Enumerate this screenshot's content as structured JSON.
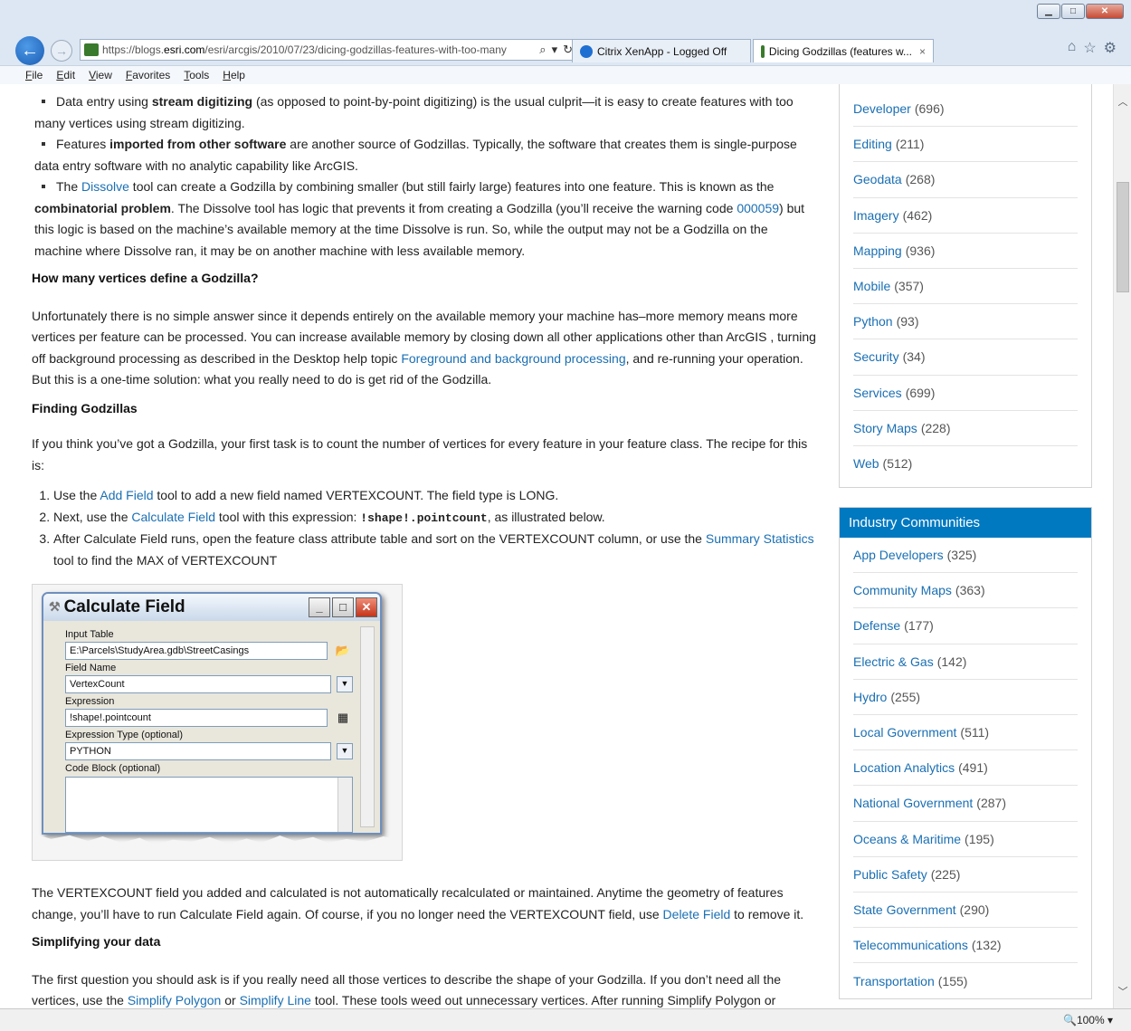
{
  "browser": {
    "url_prefix": "https://blogs.",
    "url_domain": "esri.com",
    "url_path": "/esri/arcgis/2010/07/23/dicing-godzillas-features-with-too-many",
    "tabs": [
      {
        "label": "Citrix XenApp - Logged Off"
      },
      {
        "label": "Dicing Godzillas (features w...",
        "close": "×"
      }
    ],
    "menu": [
      "File",
      "Edit",
      "View",
      "Favorites",
      "Tools",
      "Help"
    ],
    "zoom": "100%"
  },
  "article": {
    "bullet1_pre": "Data entry using ",
    "bullet1_bold": "stream digitizing",
    "bullet1_post": " (as opposed to point-by-point digitizing) is the usual culprit—it is easy to create features with too many vertices using stream digitizing.",
    "bullet2_pre": "Features ",
    "bullet2_bold": "imported from other software",
    "bullet2_post": " are another source of Godzillas. Typically, the software that creates them is single-purpose data entry software with no analytic capability like ArcGIS.",
    "bullet3_pre": "The ",
    "bullet3_link": "Dissolve",
    "bullet3_mid": " tool can create a Godzilla by combining smaller (but still fairly large) features into one feature. This is known as the ",
    "bullet3_bold": "combinatorial problem",
    "bullet3_mid2": ". The Dissolve tool has logic that prevents it from creating a Godzilla (you’ll receive the warning code ",
    "bullet3_link2": "000059",
    "bullet3_post": ") but this logic is based on the machine’s available memory at the time Dissolve is run. So, while the output may not be a Godzilla on the machine where Dissolve ran, it may be on another machine with less available memory.",
    "h_vertices": "How many vertices define a Godzilla?",
    "p_vertices_pre": "Unfortunately there is no simple answer since it depends entirely on the available memory your machine has–more memory means more vertices per feature can be processed. You can increase available memory by closing down all other applications other than ArcGIS , turning off background processing as described in the Desktop help topic ",
    "p_vertices_link": "Foreground and background processing",
    "p_vertices_post": ", and re-running your operation. But this is a one-time solution: what you really need to do is get rid of the Godzilla.",
    "h_finding": "Finding Godzillas",
    "p_finding": "If you think you’ve got a Godzilla, your first task is to count the number of vertices for every feature in your feature class. The recipe for this is:",
    "step1_pre": "Use the ",
    "step1_link": "Add Field",
    "step1_post": " tool to add a new field named VERTEXCOUNT. The field type is LONG.",
    "step2_pre": "Next, use the ",
    "step2_link": "Calculate Field",
    "step2_mid": " tool with this expression: ",
    "step2_code": "!shape!.pointcount",
    "step2_post": ", as illustrated below.",
    "step3_pre": "After Calculate Field runs, open the feature class attribute table and sort on the VERTEXCOUNT column, or use the ",
    "step3_link": "Summary Statistics",
    "step3_post": " tool to find the MAX of VERTEXCOUNT",
    "p_recalc_pre": "The VERTEXCOUNT field you added and calculated is not automatically recalculated or maintained. Anytime the geometry of features change, you’ll have to run Calculate Field again. Of course, if you no longer need the VERTEXCOUNT field, use ",
    "p_recalc_link": "Delete Field",
    "p_recalc_post": " to remove it.",
    "h_simplify": "Simplifying your data",
    "p_simplify_pre": "The first question you should ask is if you really need all those vertices to describe the shape of your Godzilla. If you don’t need all the vertices, use the ",
    "p_simplify_link1": "Simplify Polygon",
    "p_simplify_mid": " or ",
    "p_simplify_link2": "Simplify Line",
    "p_simplify_post": " tool. These tools weed out unnecessary vertices. After running Simplify Polygon or"
  },
  "dialog": {
    "title": "Calculate Field",
    "input_table_label": "Input Table",
    "input_table_value": "E:\\Parcels\\StudyArea.gdb\\StreetCasings",
    "field_name_label": "Field Name",
    "field_name_value": "VertexCount",
    "expression_label": "Expression",
    "expression_value": "!shape!.pointcount",
    "expr_type_label": "Expression Type (optional)",
    "expr_type_value": "PYTHON",
    "code_block_label": "Code Block (optional)"
  },
  "sidebar": {
    "categories": [
      {
        "name": "Developer",
        "count": "(696)"
      },
      {
        "name": "Editing",
        "count": "(211)"
      },
      {
        "name": "Geodata",
        "count": "(268)"
      },
      {
        "name": "Imagery",
        "count": "(462)"
      },
      {
        "name": "Mapping",
        "count": "(936)"
      },
      {
        "name": "Mobile",
        "count": "(357)"
      },
      {
        "name": "Python",
        "count": "(93)"
      },
      {
        "name": "Security",
        "count": "(34)"
      },
      {
        "name": "Services",
        "count": "(699)"
      },
      {
        "name": "Story Maps",
        "count": "(228)"
      },
      {
        "name": "Web",
        "count": "(512)"
      }
    ],
    "industry_title": "Industry Communities",
    "industry": [
      {
        "name": "App Developers",
        "count": "(325)"
      },
      {
        "name": "Community Maps",
        "count": "(363)"
      },
      {
        "name": "Defense",
        "count": "(177)"
      },
      {
        "name": "Electric & Gas",
        "count": "(142)"
      },
      {
        "name": "Hydro",
        "count": "(255)"
      },
      {
        "name": "Local Government",
        "count": "(511)"
      },
      {
        "name": "Location Analytics",
        "count": "(491)"
      },
      {
        "name": "National Government",
        "count": "(287)"
      },
      {
        "name": "Oceans & Maritime",
        "count": "(195)"
      },
      {
        "name": "Public Safety",
        "count": "(225)"
      },
      {
        "name": "State Government",
        "count": "(290)"
      },
      {
        "name": "Telecommunications",
        "count": "(132)"
      },
      {
        "name": "Transportation",
        "count": "(155)"
      }
    ]
  },
  "colors": {
    "link": "#1a6fb3",
    "widget_header": "#0079c1"
  }
}
